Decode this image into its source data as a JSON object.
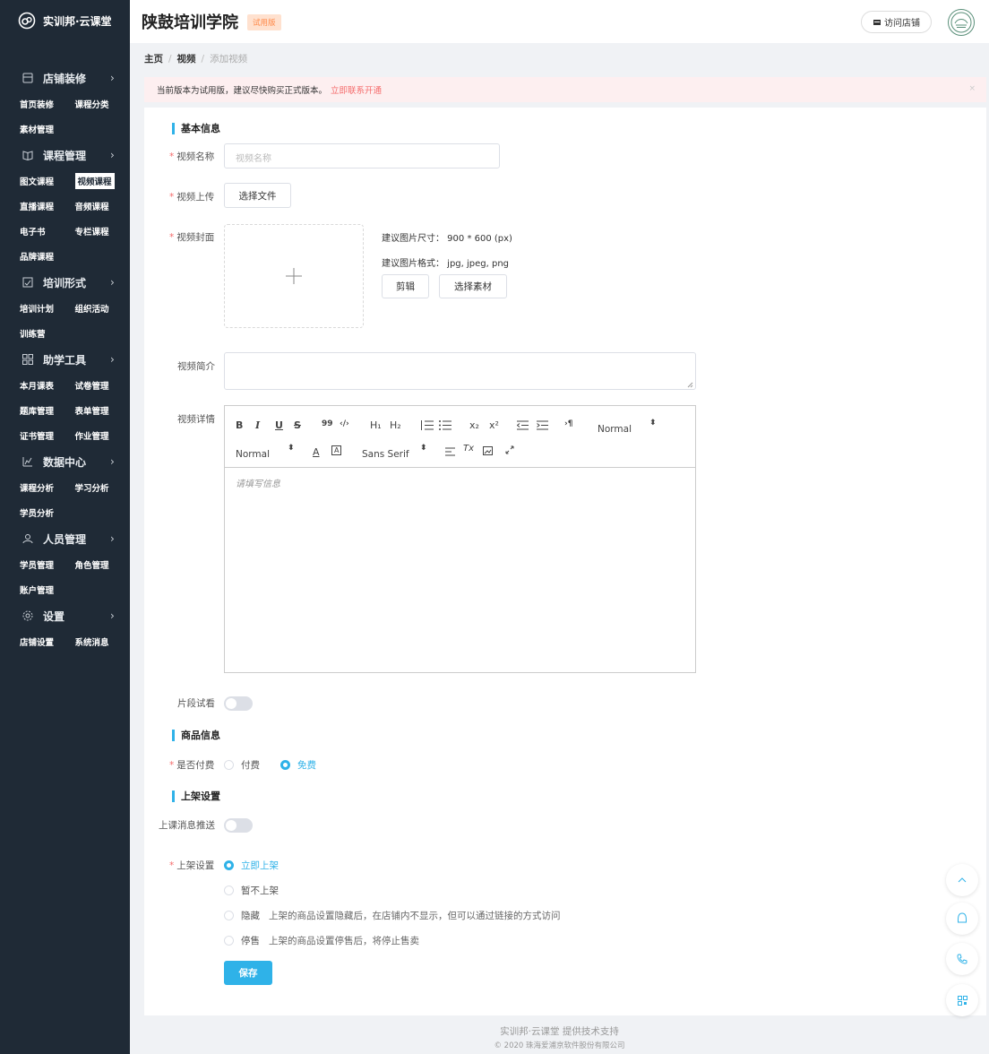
{
  "sidebar": {
    "logo_text": "实训邦·云课堂",
    "groups": [
      {
        "label": "店铺装修",
        "arrow": "›",
        "items": [
          "首页装修",
          "课程分类",
          "素材管理"
        ]
      },
      {
        "label": "课程管理",
        "arrow": "›",
        "items": [
          "图文课程",
          "视频课程",
          "直播课程",
          "音频课程",
          "电子书",
          "专栏课程",
          "品牌课程"
        ]
      },
      {
        "label": "培训形式",
        "arrow": "›",
        "items": [
          "培训计划",
          "组织活动",
          "训练营"
        ]
      },
      {
        "label": "助学工具",
        "arrow": "›",
        "items": [
          "本月课表",
          "试卷管理",
          "题库管理",
          "表单管理",
          "证书管理",
          "作业管理"
        ]
      },
      {
        "label": "数据中心",
        "arrow": "›",
        "items": [
          "课程分析",
          "学习分析",
          "学员分析"
        ]
      },
      {
        "label": "人员管理",
        "arrow": "›",
        "items": [
          "学员管理",
          "角色管理",
          "账户管理"
        ]
      },
      {
        "label": "设置",
        "arrow": "›",
        "items": [
          "店铺设置",
          "系统消息"
        ]
      }
    ],
    "active_item": "视频课程"
  },
  "header": {
    "school_name": "陕鼓培训学院",
    "trial_badge": "试用版",
    "visit_store": "访问店铺"
  },
  "breadcrumb": {
    "home": "主页",
    "sep": "/",
    "video": "视频",
    "current": "添加视频"
  },
  "notice": {
    "text": "当前版本为试用版，建议尽快购买正式版本。",
    "link": "立即联系开通",
    "close": "×"
  },
  "form": {
    "basic_title": "基本信息",
    "name_label": "视频名称",
    "name_placeholder": "视频名称",
    "upload_label": "视频上传",
    "choose_file": "选择文件",
    "cover_label": "视频封面",
    "size_hint": "建议图片尺寸：  900 * 600 (px)",
    "format_hint": "建议图片格式：  jpg, jpeg, png",
    "crop_btn": "剪辑",
    "choose_material": "选择素材",
    "intro_label": "视频简介",
    "detail_label": "视频详情",
    "editor_placeholder": "请填写信息",
    "toolbar": {
      "bold": "B",
      "italic": "I",
      "underline": "U",
      "strike": "S",
      "quote": "99",
      "code": "‹/›",
      "h1": "H₁",
      "h2": "H₂",
      "sub": "x₂",
      "sup": "x²",
      "pilcrow": "›¶",
      "header_select": "Normal",
      "size_select": "Normal",
      "font_select": "Sans Serif",
      "color": "A",
      "background": "A",
      "clean": "Tx",
      "updown": "⬍"
    },
    "preview_label": "片段试看",
    "product_title": "商品信息",
    "paid_label": "是否付费",
    "paid_options": [
      "付费",
      "免费"
    ],
    "paid_selected": "免费",
    "listing_title": "上架设置",
    "push_label": "上课消息推送",
    "listing_label": "上架设置",
    "listing_options": [
      {
        "label": "立即上架",
        "desc": ""
      },
      {
        "label": "暂不上架",
        "desc": ""
      },
      {
        "label": "隐藏",
        "desc": "上架的商品设置隐藏后，在店铺内不显示，但可以通过链接的方式访问"
      },
      {
        "label": "停售",
        "desc": "上架的商品设置停售后，将停止售卖"
      }
    ],
    "listing_selected": "立即上架",
    "save": "保存"
  },
  "footer": {
    "line1": "实训邦·云课堂 提供技术支持",
    "line2": "© 2020 珠海爱浦京软件股份有限公司"
  },
  "colors": {
    "accent": "#2fb2e8",
    "sidebar_bg": "#1f2a36",
    "notice_bg": "#fdeff0",
    "danger": "#f56c6c"
  }
}
